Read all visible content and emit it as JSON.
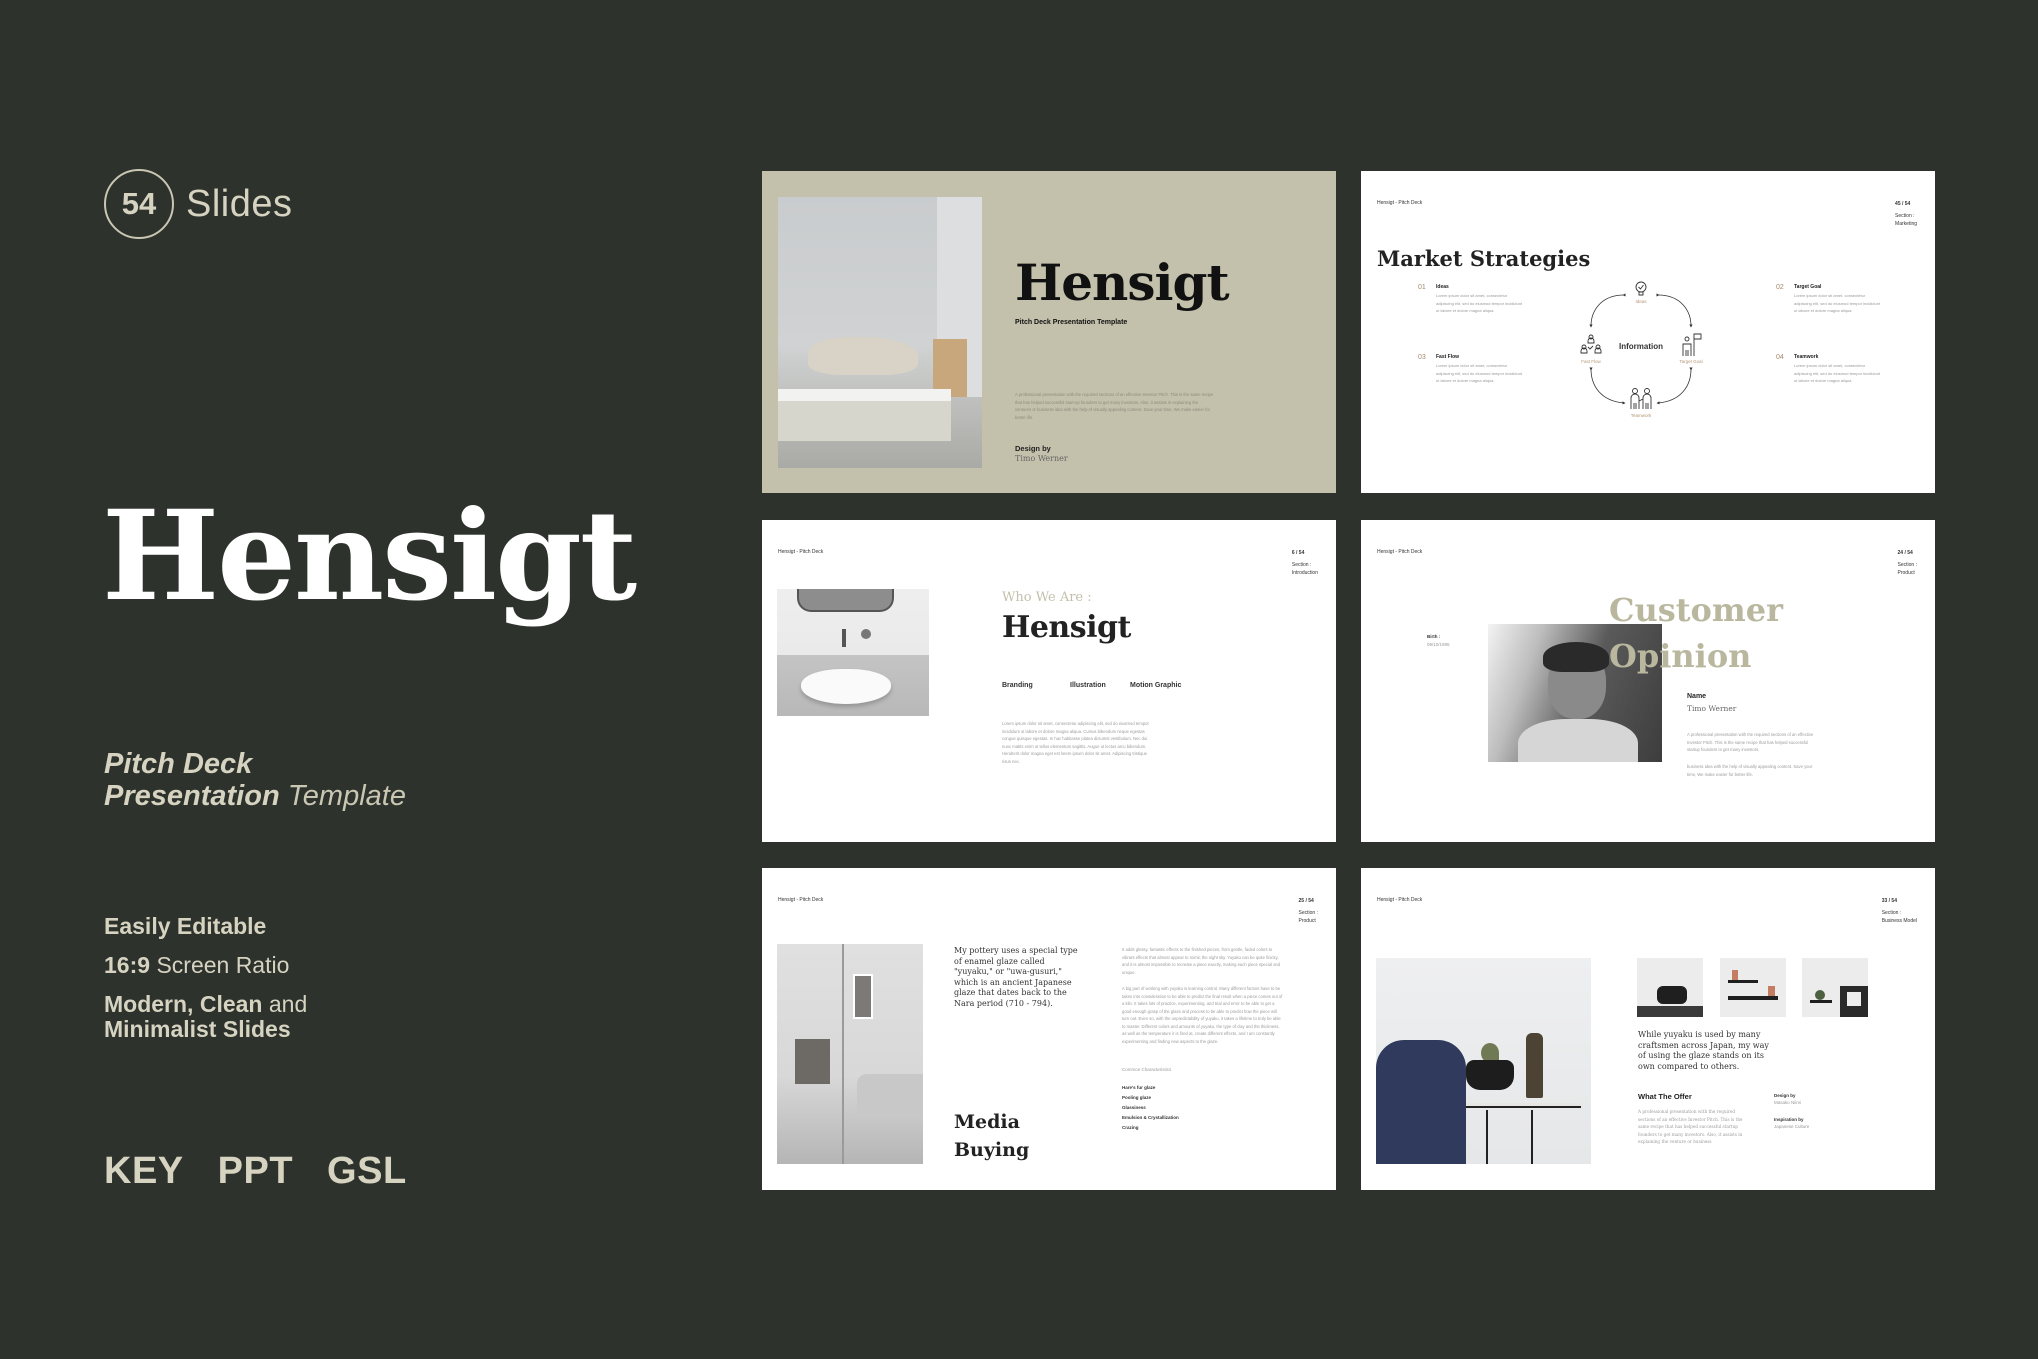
{
  "left_panel": {
    "slide_count": "54",
    "slide_count_label": "Slides",
    "title": "Hensigt",
    "tagline": {
      "line1": "Pitch Deck",
      "line2_bold": "Presentation",
      "line2_light": "Template"
    },
    "features": [
      {
        "bold": "Easily Editable",
        "light": ""
      },
      {
        "bold": "16:9",
        "light": "Screen Ratio"
      },
      {
        "bold": "Modern, Clean",
        "light": "and",
        "bold2": "Minimalist Slides"
      }
    ],
    "formats": [
      "KEY",
      "PPT",
      "GSL"
    ]
  },
  "colors": {
    "background": "#2d322d",
    "accent_beige": "#c3c0ab",
    "text_light": "#d6d3c1",
    "accent_brown": "#a58a6c"
  },
  "slides": {
    "cover": {
      "title": "Hensigt",
      "subtitle": "Pitch Deck Presentation Template",
      "paragraph": "A professional presentation with the required sections of an effective Investor Pitch. This is the same recipe that has helped successful start-up founders to get many investors. Also, it assists in explaining the ventures or business idea with the help of visually appealing content. Save your time, We make easier for better life.",
      "design_label": "Design by",
      "designer": "Timo Werner"
    },
    "market": {
      "header": "Hensigt - Pitch Deck",
      "page": "45 / 54",
      "section_label": "Section :",
      "section": "Marketing",
      "title": "Market Strategies",
      "center": "Information",
      "diagram_labels": [
        "Ideas",
        "Target Goal",
        "Teamwork",
        "Fast Flow"
      ],
      "items": [
        {
          "num": "01",
          "name": "Ideas",
          "desc": "Lorem ipsum dolor sit amet, consectetur adipiscing elit, sed do eiusmod tempor incididunt ut labore et dolore magna aliqua."
        },
        {
          "num": "02",
          "name": "Target Goal",
          "desc": "Lorem ipsum dolor sit amet, consectetur adipiscing elit, sed do eiusmod tempor incididunt ut labore et dolore magna aliqua."
        },
        {
          "num": "03",
          "name": "Fast Flow",
          "desc": "Lorem ipsum dolor sit amet, consectetur adipiscing elit, sed do eiusmod tempor incididunt ut labore et dolore magna aliqua."
        },
        {
          "num": "04",
          "name": "Teamwork",
          "desc": "Lorem ipsum dolor sit amet, consectetur adipiscing elit, sed do eiusmod tempor incididunt ut labore et dolore magna aliqua."
        }
      ]
    },
    "who": {
      "header": "Hensigt - Pitch Deck",
      "page": "6 / 54",
      "section_label": "Section :",
      "section": "Introduction",
      "kicker": "Who We Are :",
      "title": "Hensigt",
      "tags": [
        "Branding",
        "Illustration",
        "Motion Graphic"
      ],
      "paragraph": "Lorem ipsum dolor sit amet, consectetur adipiscing elit, sed do eiusmod tempor incididunt ut labore et dolore magna aliqua. Cursus bibendum neque egestas congue quisque egestas. In hac habitasse platea dictumst vestibulum. Nec dui nunc mattis enim ut tellus elementum sagittis. Augue ut lectus arcu bibendum. Hendrerit dolor magna eget est lorem ipsum dolor sit amet. Adipiscing tristique risus nec."
    },
    "opinion": {
      "header": "Hensigt - Pitch Deck",
      "page": "24 / 54",
      "section_label": "Section :",
      "section": "Product",
      "title_line1": "Customer",
      "title_line2": "Opinion",
      "birth_label": "Birth :",
      "birth": "09/10/1995",
      "name_label": "Name",
      "name": "Timo Werner",
      "paragraph1": "A professional presentation with the required sections of an effective Investor Pitch. This is the same recipe that has helped successful startup founders to get many investors.",
      "paragraph2": "business idea with the help of visually appealing content. Save your time, We make easier for better life."
    },
    "media": {
      "header": "Hensigt - Pitch Deck",
      "page": "25 / 54",
      "section_label": "Section :",
      "section": "Product",
      "quote": "My pottery uses a special type of enamel glaze called \"yuyaku,\" or \"uwa-gusuri,\" which is an ancient Japanese glaze that dates back to the Nara period (710 - 794).",
      "title_line1": "Media",
      "title_line2": "Buying",
      "paragraph1": "It adds glossy, fantastic effects to the finished pieces, from gentle, faded colors to vibrant effects that almost appear to mimic the night sky. Yuyaku can be quite finicky, and it is almost impossible to recreate a piece exactly, making each piece special and unique.",
      "paragraph2": "A big part of working with yuyaku is learning control. Many different factors have to be taken into consideration to be able to predict the final result when a piece comes out of a kiln. It takes lots of practice, experimenting, and trial and error to be able to get a good enough grasp of the glaze and process to be able to predict how the piece will turn out. Even so, with the unpredictability of yuyaku, it takes a lifetime to truly be able to master. Different colors and amounts of yuyaku, the type of clay and the thickness, as well as the temperature it is fired at, create different effects, and I am constantly experimenting and finding new aspects to the glaze.",
      "list_title": "Common Characteristics",
      "list": [
        "Hare's fur glaze",
        "Pooling glaze",
        "Glassiness",
        "Emulsion & Crystallization",
        "Crazing"
      ]
    },
    "offer": {
      "header": "Hensigt - Pitch Deck",
      "page": "33 / 54",
      "section_label": "Section :",
      "section": "Business Model",
      "quote": "While yuyaku is used by many craftsmen across Japan, my way of using the glaze stands on its own compared to others.",
      "offer_title": "What The Offer",
      "paragraph": "A professional presentation with the required sections of an effective Investor Pitch. This is the same recipe that has helped successful startup founders to get many investors. Also, it assists in explaining the venture or business",
      "design_label": "Design by",
      "designer": "Masako Niimi",
      "inspiration_label": "Inspiration by",
      "inspiration": "Japanese Culture"
    }
  }
}
